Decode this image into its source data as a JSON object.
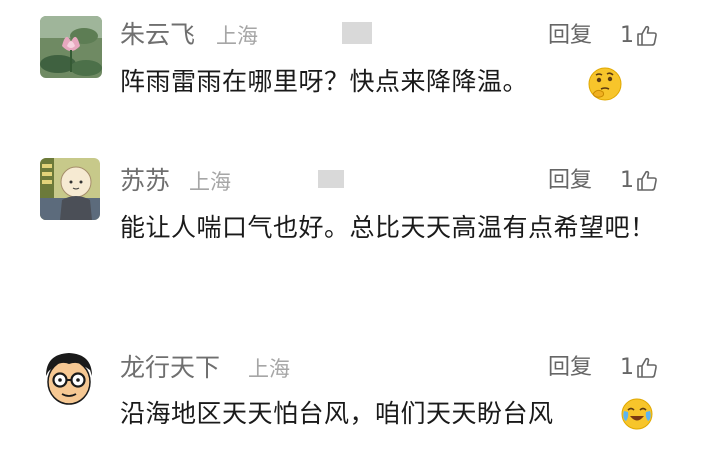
{
  "comments": [
    {
      "username": "朱云飞",
      "location": "上海",
      "reply_label": "回复",
      "like_count": "1",
      "text": "阵雨雷雨在哪里呀？快点来降降温。",
      "emoji": "thinking-face-icon"
    },
    {
      "username": "苏苏",
      "location": "上海",
      "reply_label": "回复",
      "like_count": "1",
      "text": "能让人喘口气也好。总比天天高温有点希望吧！"
    },
    {
      "username": "龙行天下",
      "location": "上海",
      "reply_label": "回复",
      "like_count": "1",
      "text": "沿海地区天天怕台风，咱们天天盼台风",
      "emoji": "crying-face-icon"
    }
  ],
  "colors": {
    "username": "#6f6f6f",
    "location": "#a6a6a6",
    "text": "#1a1a1a",
    "reply": "#666666",
    "emoji_yellow": "#f7c52b"
  }
}
